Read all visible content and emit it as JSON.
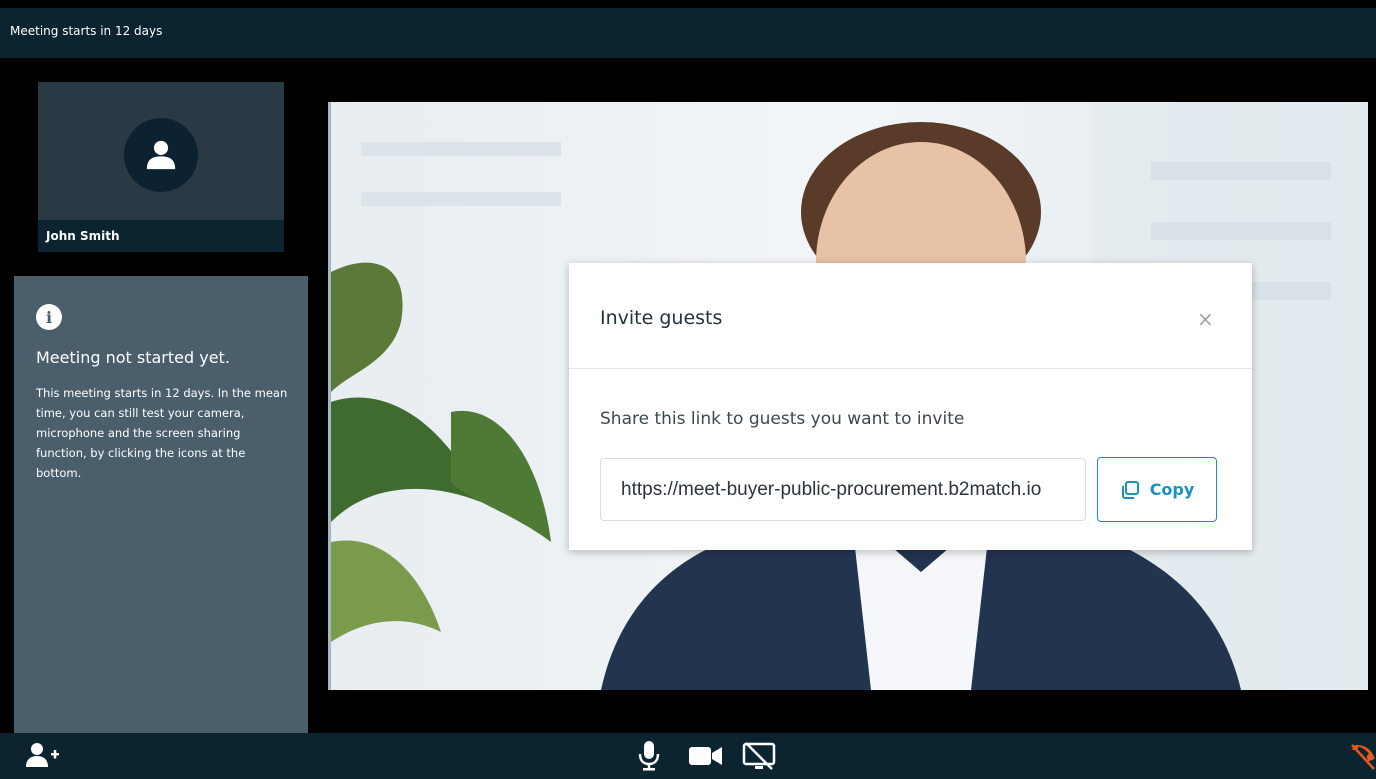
{
  "header": {
    "title": "Meeting starts in 12 days"
  },
  "self_tile": {
    "name": "John Smith",
    "avatar_icon": "user-icon"
  },
  "info_panel": {
    "icon": "info-icon",
    "icon_glyph": "i",
    "title": "Meeting not started yet.",
    "text": "This meeting starts in 12 days. In the mean time, you can still test your camera, microphone and the screen sharing function, by clicking the icons at the bottom."
  },
  "modal": {
    "title": "Invite guests",
    "close_glyph": "×",
    "label": "Share this link to guests you want to invite",
    "link_value": "https://meet-buyer-public-procurement.b2match.io",
    "copy_label": "Copy"
  },
  "toolbar": {
    "icons": [
      "add-user-icon",
      "microphone-icon",
      "camera-icon",
      "screen-share-off-icon",
      "hang-up-icon"
    ]
  },
  "colors": {
    "topbar": "#0b2430",
    "panel": "#4a5e6b",
    "accent": "#1a8fc0",
    "hangup": "#e8581c"
  }
}
